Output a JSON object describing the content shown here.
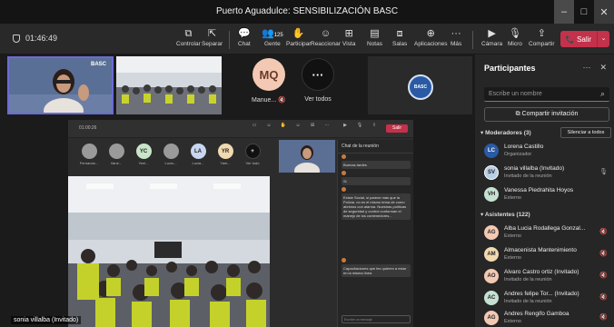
{
  "window": {
    "title": "Puerto Aguadulce: SENSIBILIZACIÓN BASC",
    "controls": {
      "minimize": "–",
      "maximize": "□",
      "close": "✕"
    }
  },
  "toolbar": {
    "timer": "01:46:49",
    "buttons": [
      {
        "id": "controlar",
        "label": "Controlar",
        "icon": "⧉"
      },
      {
        "id": "separar",
        "label": "Separar",
        "icon": "⇱"
      },
      {
        "id": "chat",
        "label": "Chat",
        "icon": "💬"
      },
      {
        "id": "gente",
        "label": "Gente",
        "icon": "👥",
        "count": "125"
      },
      {
        "id": "participar",
        "label": "Participar",
        "icon": "✋"
      },
      {
        "id": "reaccionar",
        "label": "Reaccionar",
        "icon": "☺"
      },
      {
        "id": "vista",
        "label": "Vista",
        "icon": "⊞"
      },
      {
        "id": "notas",
        "label": "Notas",
        "icon": "▤"
      },
      {
        "id": "salas",
        "label": "Salas",
        "icon": "⧈"
      },
      {
        "id": "aplicaciones",
        "label": "Aplicaciones",
        "icon": "⊕"
      },
      {
        "id": "mas",
        "label": "Más",
        "icon": "···"
      },
      {
        "id": "camara",
        "label": "Cámara",
        "icon": "▶"
      },
      {
        "id": "micro",
        "label": "Micro",
        "icon": "🎙"
      },
      {
        "id": "compartir",
        "label": "Compartir",
        "icon": "⇪"
      }
    ],
    "leave_label": "Salir",
    "leave_icon": "📞",
    "dropdown_icon": "⌄"
  },
  "stage": {
    "avatar_tiles": [
      {
        "initials": "MQ",
        "name": "Manue...",
        "color": "#f3c9b4"
      },
      {
        "initials": "···",
        "name": "Ver todos",
        "color": "#111111"
      }
    ],
    "speaker_label": "sonia villalba (Invitado)",
    "logo_text": "BASC",
    "tile1_badge": "BASC"
  },
  "shared_screen": {
    "time": "01:00:26",
    "leave": "Salir",
    "avatars": [
      {
        "initials": "",
        "name": "Fernando...",
        "color": "#9a9a9a"
      },
      {
        "initials": "",
        "name": "Vane...",
        "color": "#9a9a9a"
      },
      {
        "initials": "YC",
        "name": "Yeni...",
        "color": "#c9e5c9"
      },
      {
        "initials": "",
        "name": "Lucio...",
        "color": "#9a9a9a"
      },
      {
        "initials": "LA",
        "name": "Lucia...",
        "color": "#c8d6f0"
      },
      {
        "initials": "YR",
        "name": "Yam...",
        "color": "#f1d9b0"
      },
      {
        "initials": "+",
        "name": "Ver todo",
        "color": "#111111"
      }
    ],
    "chat_title": "Chat de la reunión",
    "notif": "Reacciones rápidas de la reunión",
    "messages": [
      {
        "text": "Buenas tardes"
      },
      {
        "text": "Si"
      },
      {
        "text": "Existe Social, si parece más que la Polícia. no es el mismo tema de como abrimos con alarma. Nuestras políticas de seguridad y control conforman el manejo de los contenedores..."
      },
      {
        "text": "Capacitaciones que les quieren a estar en la misma línea"
      }
    ],
    "input_placeholder": "Escribe un mensaje"
  },
  "participants": {
    "title": "Participantes",
    "more_icon": "···",
    "close_icon": "✕",
    "search_placeholder": "Escribe un nombre",
    "share_invite": "Compartir invitación",
    "moderators_header": "Moderadores (3)",
    "mute_all": "Silenciar a todos",
    "attendees_header": "Asistentes (122)",
    "moderators": [
      {
        "initials": "LC",
        "name": "Lorena Castillo",
        "role": "Organizador",
        "color": "#2b5aa5"
      },
      {
        "initials": "SV",
        "name": "sonia villalba (Invitado)",
        "role": "Invitado de la reunión",
        "color": "#b6cfe6"
      },
      {
        "initials": "VH",
        "name": "Vanessa Piedrahita Hoyos",
        "role": "Externo",
        "color": "#c6e1d1"
      }
    ],
    "attendees": [
      {
        "initials": "AG",
        "name": "Alba Lucia Rodallega Gonzal...",
        "role": "Externo",
        "color": "#f3c9b4"
      },
      {
        "initials": "AM",
        "name": "Almacenista Mantenimiento",
        "role": "Externo",
        "color": "#f1d9b0"
      },
      {
        "initials": "AO",
        "name": "Alvaro Castro ortiz (Invitado)",
        "role": "Invitado de la reunión",
        "color": "#f3c9b4"
      },
      {
        "initials": "AC",
        "name": "Andres felipe Tor... (Invitado)",
        "role": "Invitado de la reunión",
        "color": "#c6e1d1"
      },
      {
        "initials": "AG",
        "name": "Andres Rengifo Gamboa",
        "role": "Externo",
        "color": "#f3c9b4"
      }
    ]
  }
}
